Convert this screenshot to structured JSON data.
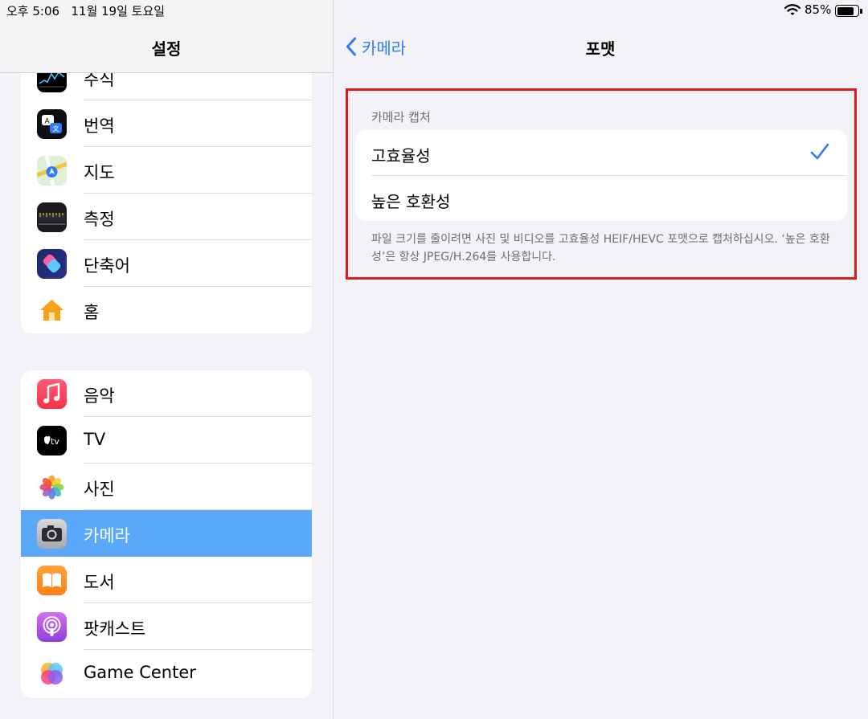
{
  "status_bar": {
    "time": "오후 5:06   11월 19일 토요일",
    "battery_percent": "85%",
    "battery_level": 0.85
  },
  "sidebar": {
    "title": "설정",
    "group1": [
      {
        "label": "주식",
        "icon": "stocks-icon"
      },
      {
        "label": "번역",
        "icon": "translate-icon"
      },
      {
        "label": "지도",
        "icon": "maps-icon"
      },
      {
        "label": "측정",
        "icon": "measure-icon"
      },
      {
        "label": "단축어",
        "icon": "shortcuts-icon"
      },
      {
        "label": "홈",
        "icon": "home-icon"
      }
    ],
    "group2": [
      {
        "label": "음악",
        "icon": "music-icon"
      },
      {
        "label": "TV",
        "icon": "tv-icon",
        "icon_text": "tv"
      },
      {
        "label": "사진",
        "icon": "photos-icon"
      },
      {
        "label": "카메라",
        "icon": "camera-icon",
        "selected": true
      },
      {
        "label": "도서",
        "icon": "books-icon"
      },
      {
        "label": "팟캐스트",
        "icon": "podcasts-icon"
      },
      {
        "label": "Game Center",
        "icon": "game-center-icon"
      }
    ]
  },
  "detail": {
    "back_label": "카메라",
    "title": "포맷",
    "section_header": "카메라 캡처",
    "options": [
      {
        "label": "고효율성",
        "checked": true
      },
      {
        "label": "높은 호환성",
        "checked": false
      }
    ],
    "footer": "파일 크기를 줄이려면 사진 및 비디오를 고효율성 HEIF/HEVC 포맷으로 캡처하십시오. ‘높은 호환성’은 항상 JPEG/H.264를 사용합니다."
  },
  "colors": {
    "accent": "#2f7cf6",
    "selected_row": "#5aa8f8",
    "highlight_border": "#e0191b"
  }
}
